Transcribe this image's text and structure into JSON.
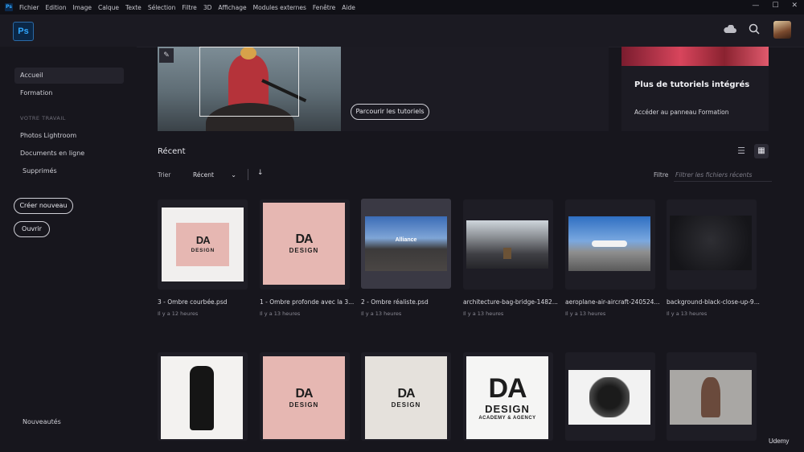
{
  "menubar": {
    "app_icon": "ps-mini-icon",
    "items": [
      "Fichier",
      "Edition",
      "Image",
      "Calque",
      "Texte",
      "Sélection",
      "Filtre",
      "3D",
      "Affichage",
      "Modules externes",
      "Fenêtre",
      "Aide"
    ],
    "controls": [
      "minimize-icon",
      "maximize-icon",
      "close-icon"
    ]
  },
  "topbar": {
    "logo_text": "Ps",
    "icons": [
      "cloud-icon",
      "search-icon",
      "avatar"
    ]
  },
  "sidebar": {
    "nav": [
      {
        "label": "Accueil",
        "active": true
      },
      {
        "label": "Formation",
        "active": false
      }
    ],
    "section_label": "VOTRE TRAVAIL",
    "work_items": [
      "Photos Lightroom",
      "Documents en ligne",
      "Supprimés"
    ],
    "create_button": "Créer nouveau",
    "open_button": "Ouvrir",
    "whats_new": "Nouveautés"
  },
  "promo": {
    "browse_button": "Parcourir les tutoriels",
    "title": "Plus de tutoriels intégrés",
    "link": "Accéder au panneau Formation"
  },
  "recent": {
    "title": "Récent",
    "sort_label": "Trier",
    "sort_value": "Récent",
    "sort_direction_icon": "arrow-down-icon",
    "filter_label": "Filtre",
    "filter_placeholder": "Filtrer les fichiers récents",
    "view_icons": [
      "list-view-icon",
      "grid-view-icon"
    ],
    "files_row1": [
      {
        "name": "3 - Ombre courbée.psd",
        "time": "Il y a 12 heures"
      },
      {
        "name": "1 - Ombre profonde avec la 3...",
        "time": "Il y a 13 heures"
      },
      {
        "name": "2 - Ombre réaliste.psd",
        "time": "Il y a 13 heures",
        "thumb_text": "Alliance"
      },
      {
        "name": "architecture-bag-bridge-1482...",
        "time": "Il y a 13 heures"
      },
      {
        "name": "aeroplane-air-aircraft-240524...",
        "time": "Il y a 13 heures"
      },
      {
        "name": "background-black-close-up-9...",
        "time": "Il y a 13 heures"
      }
    ],
    "logo": {
      "da": "DA",
      "design": "DESIGN",
      "academy": "ACADEMY & AGENCY"
    }
  },
  "watermark": "Udemy",
  "colors": {
    "background": "#17161d",
    "panel": "#1c1b23",
    "ps_blue": "#31a8ff",
    "logo_pink": "#e6b7b2"
  }
}
